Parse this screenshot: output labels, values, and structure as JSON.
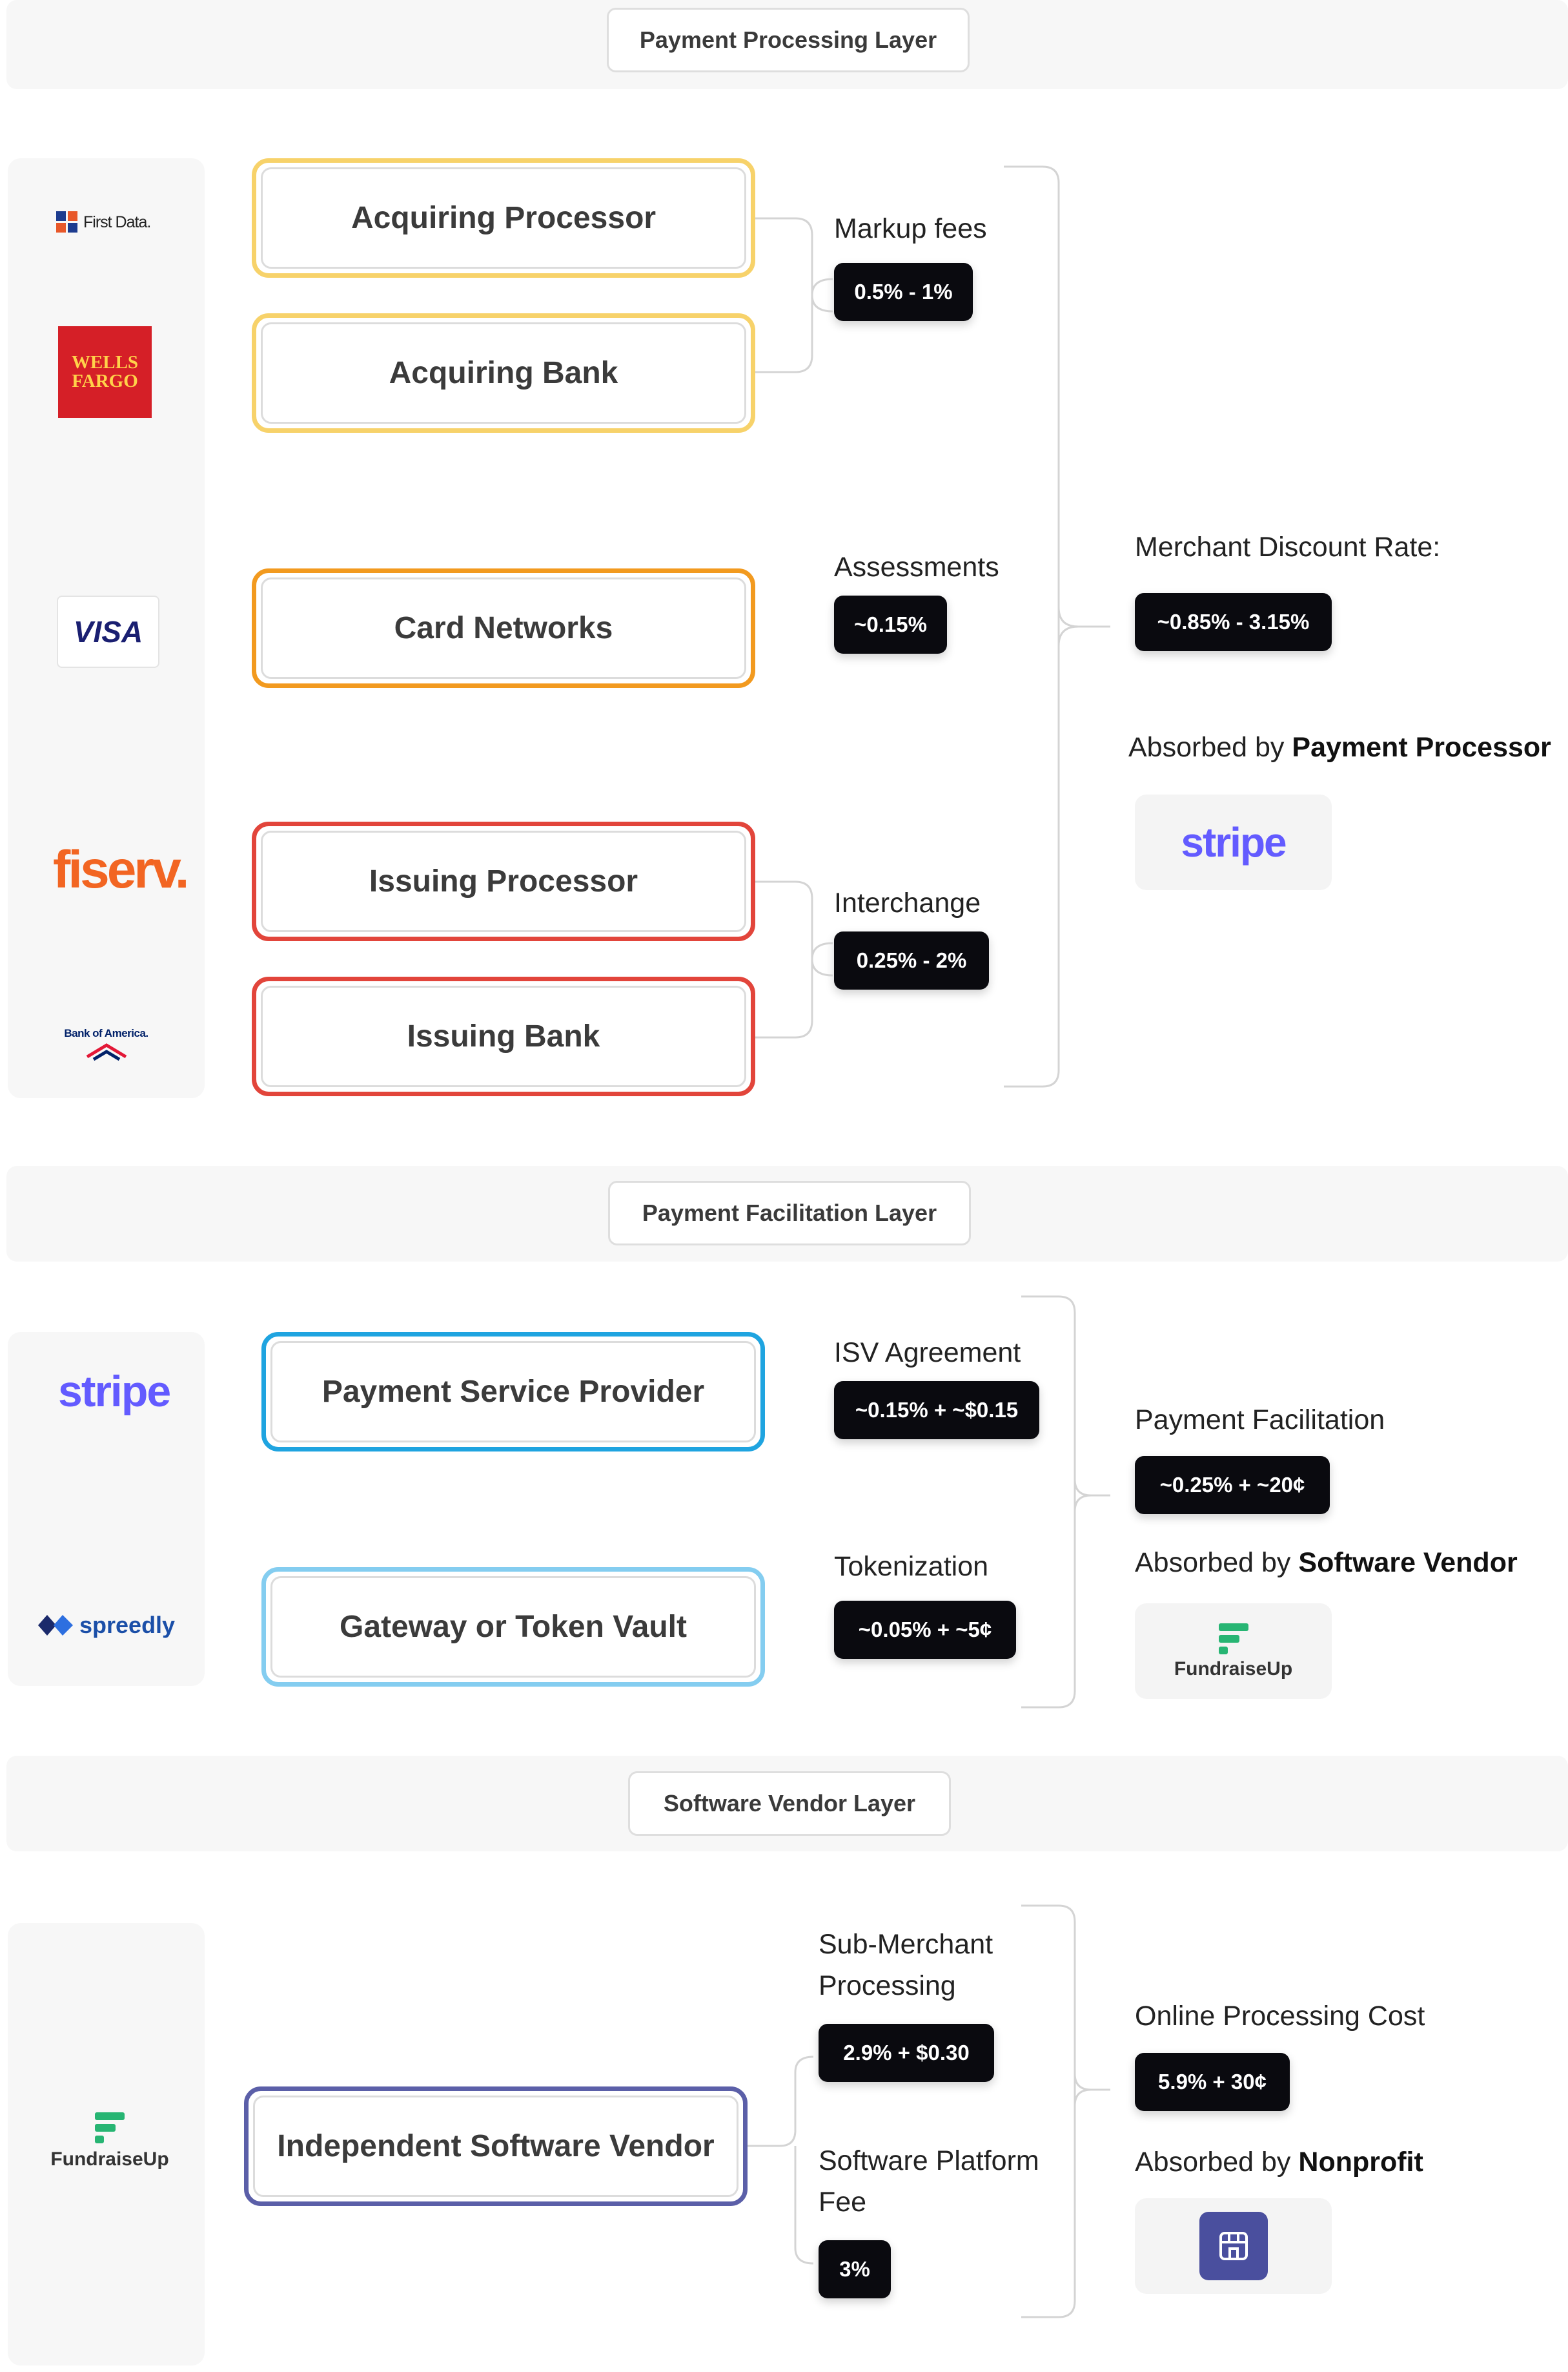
{
  "layers": {
    "processing": {
      "title": "Payment Processing Layer",
      "logos": {
        "firstdata": "First Data.",
        "wellsfargo": "WELLS FARGO",
        "visa": "VISA",
        "fiserv": "fiserv.",
        "bofa": "Bank of America."
      },
      "boxes": {
        "acquiring_processor": "Acquiring Processor",
        "acquiring_bank": "Acquiring Bank",
        "card_networks": "Card Networks",
        "issuing_processor": "Issuing Processor",
        "issuing_bank": "Issuing Bank"
      },
      "fees": {
        "markup_label": "Markup fees",
        "markup_value": "0.5% - 1%",
        "assess_label": "Assessments",
        "assess_value": "~0.15%",
        "interchange_label": "Interchange",
        "interchange_value": "0.25% - 2%"
      },
      "summary": {
        "label": "Merchant Discount Rate:",
        "value": "~0.85% - 3.15%",
        "absorbed_prefix": "Absorbed by ",
        "absorbed_by": "Payment Processor",
        "logo": "stripe"
      }
    },
    "facilitation": {
      "title": "Payment Facilitation Layer",
      "logos": {
        "stripe": "stripe",
        "spreedly": "spreedly"
      },
      "boxes": {
        "psp": "Payment Service Provider",
        "gateway": "Gateway or Token Vault"
      },
      "fees": {
        "isv_label": "ISV Agreement",
        "isv_value": "~0.15% + ~$0.15",
        "token_label": "Tokenization",
        "token_value": "~0.05% + ~5¢"
      },
      "summary": {
        "label": "Payment Facilitation",
        "value": "~0.25% + ~20¢",
        "absorbed_prefix": "Absorbed by ",
        "absorbed_by": "Software Vendor",
        "logo": "FundraiseUp"
      }
    },
    "software": {
      "title": "Software Vendor Layer",
      "logos": {
        "fundraiseup": "FundraiseUp"
      },
      "boxes": {
        "isv": "Independent Software Vendor"
      },
      "fees": {
        "sub_label_1": "Sub-Merchant",
        "sub_label_2": "Processing",
        "sub_value": "2.9% + $0.30",
        "platform_label_1": "Software Platform",
        "platform_label_2": "Fee",
        "platform_value": "3%"
      },
      "summary": {
        "label": "Online Processing Cost",
        "value": "5.9% + 30¢",
        "absorbed_prefix": "Absorbed by ",
        "absorbed_by": "Nonprofit",
        "icon": "store-icon"
      }
    }
  },
  "colors": {
    "acquiring": "#f7d26a",
    "networks": "#f29a1f",
    "issuing": "#e2453b",
    "psp": "#1fa4e0",
    "gateway": "#84cdf0",
    "isv": "#5b5fa8",
    "stripe": "#635bff",
    "fundraiseup": "#27b573"
  }
}
